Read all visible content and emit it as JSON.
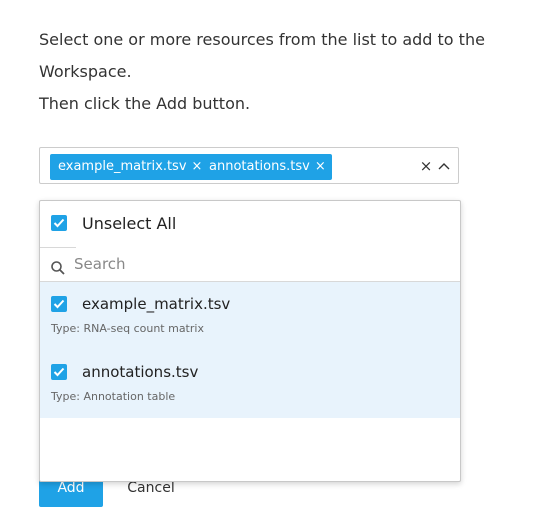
{
  "instructions": {
    "line1": "Select one or more resources from the list to add to the",
    "line2": "Workspace.",
    "line3": "Then click the Add button."
  },
  "selected_chips": [
    {
      "label": "example_matrix.tsv"
    },
    {
      "label": "annotations.tsv"
    }
  ],
  "controls": {
    "remove_glyph": "×",
    "clear_glyph": "×"
  },
  "dropdown": {
    "unselect_all_label": "Unselect All",
    "search_placeholder": "Search",
    "search_value": "",
    "options": [
      {
        "name": "example_matrix.tsv",
        "type": "Type: RNA-seq count matrix",
        "checked": true
      },
      {
        "name": "annotations.tsv",
        "type": "Type: Annotation table",
        "checked": true
      }
    ]
  },
  "buttons": {
    "add_label": "Add",
    "cancel_label": "Cancel"
  },
  "colors": {
    "accent": "#1fa2e6",
    "selected_row_bg": "#e8f3fc",
    "text": "#333333"
  }
}
